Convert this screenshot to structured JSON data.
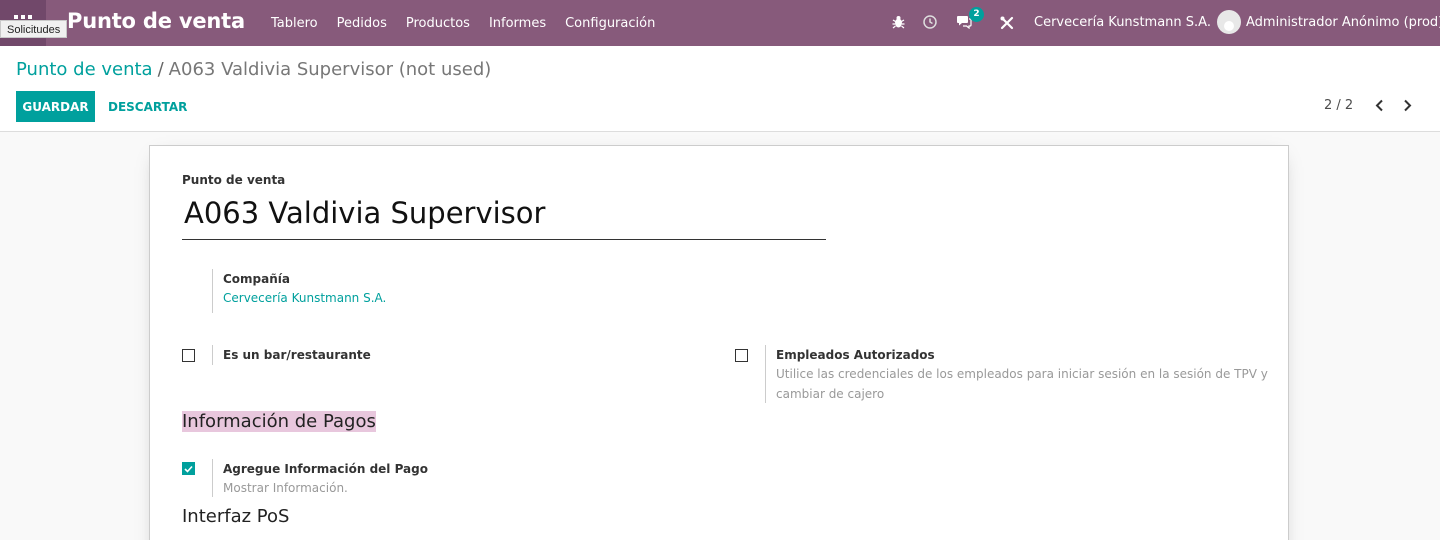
{
  "navbar": {
    "tooltip": "Solicitudes",
    "brand": "Punto de venta",
    "menu": [
      "Tablero",
      "Pedidos",
      "Productos",
      "Informes",
      "Configuración"
    ],
    "messages_badge": "2",
    "company": "Cervecería Kunstmann S.A.",
    "user": "Administrador Anónimo (prod)"
  },
  "breadcrumb": {
    "parent": "Punto de venta",
    "separator": "/",
    "current": "A063 Valdivia Supervisor (not used)"
  },
  "actions": {
    "save": "GUARDAR",
    "discard": "DESCARTAR"
  },
  "pager": {
    "text": "2 / 2"
  },
  "form": {
    "name_label": "Punto de venta",
    "name_value": "A063 Valdivia Supervisor",
    "company_label": "Compañía",
    "company_value": "Cervecería Kunstmann S.A.",
    "bar_label": "Es un bar/restaurante",
    "employees_label": "Empleados Autorizados",
    "employees_help_line1": "Utilice las credenciales de los empleados para iniciar sesión en la sesión de TPV y",
    "employees_help_line2": "cambiar de cajero",
    "payments_section": "Información de Pagos",
    "payment_info_label": "Agregue Información del Pago",
    "payment_info_help": "Mostrar Información.",
    "pos_section": "Interfaz PoS"
  },
  "colors": {
    "navbar": "#875a7b",
    "accent": "#00a09d"
  }
}
